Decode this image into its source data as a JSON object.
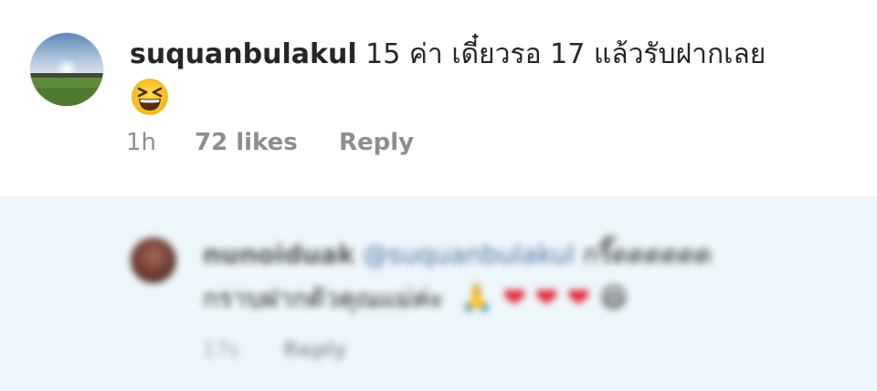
{
  "comment": {
    "username": "suquanbulakul",
    "text": "15 ค่า เดี๋ยวรอ 17 แล้วรับฝากเลย",
    "emoji": "grinning-squinting-face",
    "time": "1h",
    "likes": "72 likes",
    "reply_label": "Reply"
  },
  "reply": {
    "username": "nunoiduak",
    "mention": "@suquanbulakul",
    "text_line1": "กรี๊ดดดดดด",
    "text_line2": "กราบฝากตัวคุณแม่ค่ะ",
    "emojis": [
      "🙏",
      "❤",
      "❤",
      "❤",
      "😆"
    ],
    "time": "17s",
    "reply_label": "Reply"
  },
  "colors": {
    "text": "#262626",
    "meta": "#8e8e8e",
    "reply_background": "#eef7fb",
    "heart": "#e02030",
    "emoji_yellow": "#f7c521"
  }
}
